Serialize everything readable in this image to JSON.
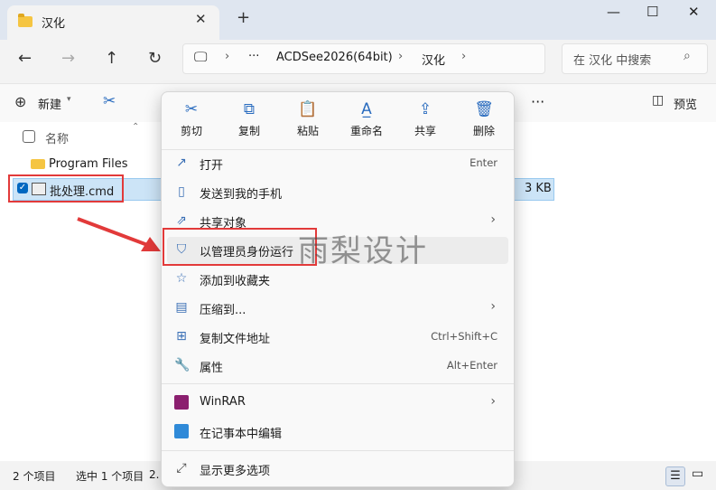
{
  "window": {
    "tab_title": "汉化",
    "tab_close": "✕",
    "new_tab": "+",
    "minimize": "—",
    "maximize": "☐",
    "close": "✕"
  },
  "address": {
    "crumbs": [
      "ACDSee2026(64bit)",
      "汉化"
    ],
    "more": "···",
    "search_placeholder": "在 汉化 中搜索"
  },
  "toolbar": {
    "new_label": "新建",
    "more": "···",
    "preview_label": "预览"
  },
  "columns": {
    "name": "名称"
  },
  "files": [
    {
      "name": "Program Files",
      "size": ""
    },
    {
      "name": "批处理.cmd",
      "size": "3 KB",
      "selected": true
    }
  ],
  "context_menu": {
    "quick_actions": [
      {
        "label": "剪切",
        "icon": "scissors-icon"
      },
      {
        "label": "复制",
        "icon": "copy-icon"
      },
      {
        "label": "粘贴",
        "icon": "paste-icon"
      },
      {
        "label": "重命名",
        "icon": "rename-icon"
      },
      {
        "label": "共享",
        "icon": "share-icon"
      },
      {
        "label": "删除",
        "icon": "trash-icon"
      }
    ],
    "items": [
      {
        "label": "打开",
        "shortcut": "Enter",
        "icon": "open-icon"
      },
      {
        "label": "发送到我的手机",
        "shortcut": "",
        "icon": "phone-icon"
      },
      {
        "label": "共享对象",
        "shortcut": "",
        "icon": "share-to-icon",
        "submenu": true
      },
      {
        "label": "以管理员身份运行",
        "shortcut": "",
        "icon": "shield-icon"
      },
      {
        "label": "添加到收藏夹",
        "shortcut": "",
        "icon": "star-icon"
      },
      {
        "label": "压缩到...",
        "shortcut": "",
        "icon": "zip-icon",
        "submenu": true
      },
      {
        "label": "复制文件地址",
        "shortcut": "Ctrl+Shift+C",
        "icon": "copy-path-icon"
      },
      {
        "label": "属性",
        "shortcut": "Alt+Enter",
        "icon": "wrench-icon"
      },
      {
        "label": "WinRAR",
        "shortcut": "",
        "icon": "winrar-icon",
        "submenu": true
      },
      {
        "label": "在记事本中编辑",
        "shortcut": "",
        "icon": "notepad-icon"
      },
      {
        "label": "显示更多选项",
        "shortcut": "",
        "icon": "more-options-icon"
      }
    ]
  },
  "status": {
    "item_count": "2 个项目",
    "selected": "选中 1 个项目",
    "selected_size": "2."
  },
  "watermark": "雨梨设计",
  "colors": {
    "accent": "#0067c0",
    "highlight_red": "#e23a3a"
  }
}
